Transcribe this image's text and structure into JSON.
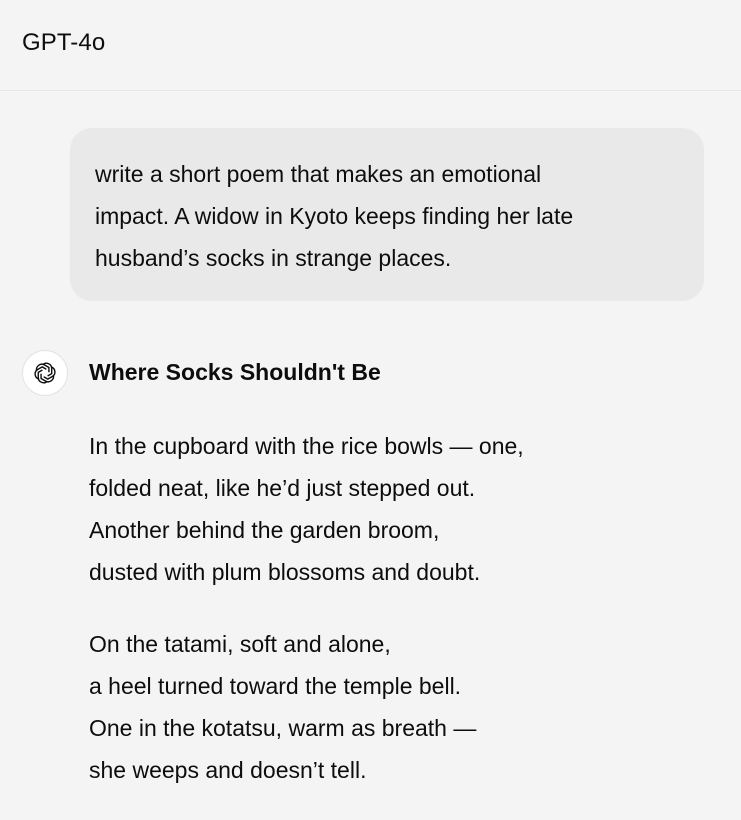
{
  "header": {
    "model_name": "GPT-4o"
  },
  "conversation": {
    "user_message": {
      "lines": [
        "write a short poem that makes an emotional",
        "impact. A widow in Kyoto keeps finding her late",
        "husband’s socks in strange places."
      ]
    },
    "assistant_message": {
      "avatar_icon": "openai-logo-icon",
      "title": "Where Socks Shouldn't Be",
      "stanzas": [
        {
          "lines": [
            "In the cupboard with the rice bowls — one,",
            "folded neat, like he’d just stepped out.",
            "Another behind the garden broom,",
            "dusted with plum blossoms and doubt."
          ]
        },
        {
          "lines": [
            "On the tatami, soft and alone,",
            "a heel turned toward the temple bell.",
            "One in the kotatsu, warm as breath —",
            "she weeps and doesn’t tell."
          ]
        }
      ]
    }
  },
  "colors": {
    "page_background": "#f4f4f4",
    "user_bubble": "#e9e9e9",
    "text": "#0d0d0d"
  }
}
